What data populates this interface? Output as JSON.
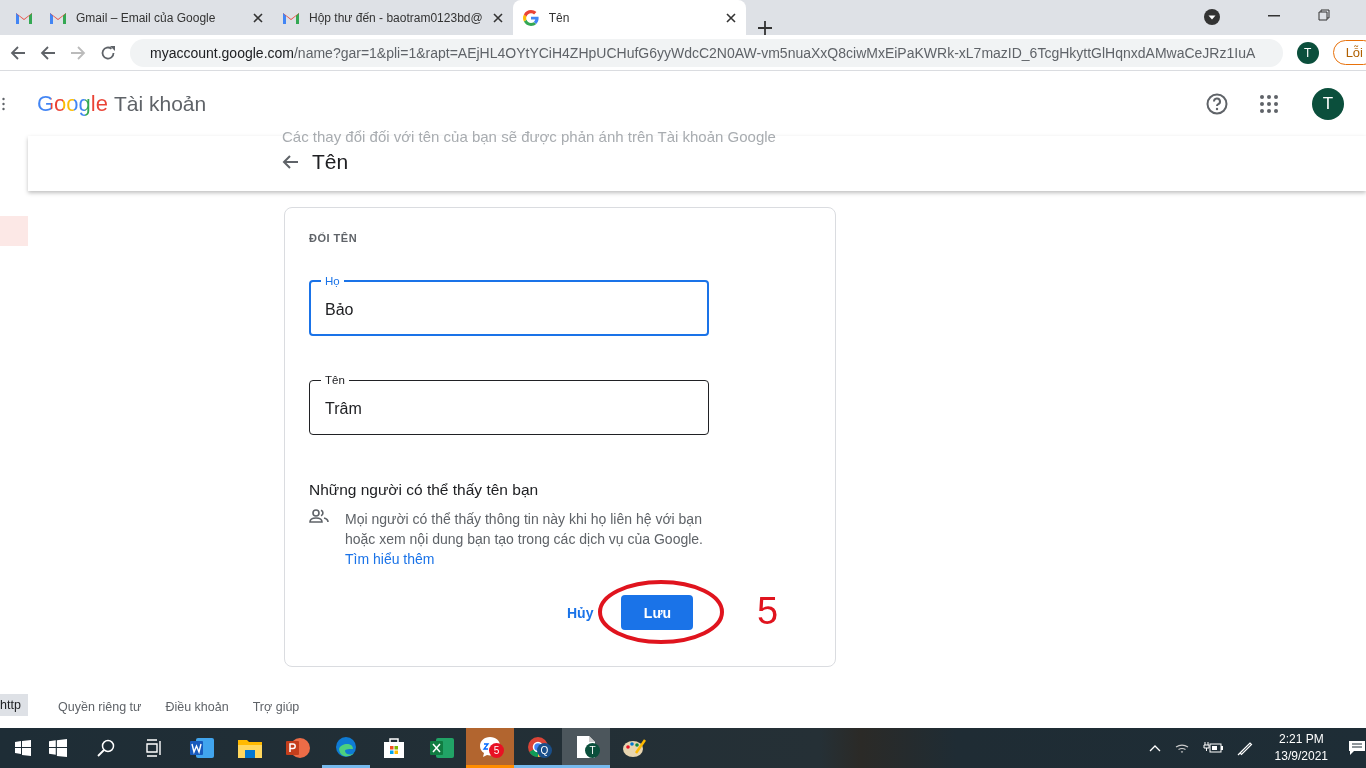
{
  "browser": {
    "tabs": [
      {
        "kind": "pinned",
        "selected": false
      },
      {
        "kind": "normal",
        "title": "Gmail – Email của Google",
        "selected": false
      },
      {
        "kind": "normal",
        "title": "Hộp thư đến - baotram0123bd@",
        "selected": false
      },
      {
        "kind": "normal",
        "title": "Tên",
        "selected": true
      }
    ],
    "url_host": "myaccount.google.com",
    "url_path": "/name?gar=1&pli=1&rapt=AEjHL4OYtYCiH4ZHpUCHufG6yyWdcC2N0AW-vm5nuaXxQ8ciwMxEiPaKWRk-xL7mazID_6TcgHkyttGlHqnxdAMwaCeJRz1IuA",
    "profile": "T",
    "error_button": "Lỗi"
  },
  "app": {
    "brand": "Google",
    "product": "Tài khoản",
    "avatar": "T",
    "notice": "Các thay đổi đối với tên của bạn sẽ được phản ánh trên Tài khoản Google",
    "title": "Tên",
    "card": {
      "section_label": "ĐỔI TÊN",
      "fields": [
        {
          "label": "Họ",
          "value": "Bảo",
          "focused": true
        },
        {
          "label": "Tên",
          "value": "Trâm",
          "focused": false
        }
      ],
      "visibility_heading": "Những người có thể thấy tên bạn",
      "visibility_text": "Mọi người có thể thấy thông tin này khi họ liên hệ với bạn hoặc xem nội dung bạn tạo trong các dịch vụ của Google.",
      "learn_more": "Tìm hiểu thêm",
      "cancel": "Hủy",
      "save": "Lưu",
      "annotation": "5"
    },
    "footer": [
      "Quyền riêng tư",
      "Điều khoản",
      "Trợ giúp"
    ],
    "status_tooltip": "http"
  },
  "taskbar": {
    "items": [
      {
        "kind": "start"
      },
      {
        "kind": "windows"
      },
      {
        "kind": "search"
      },
      {
        "kind": "taskview"
      },
      {
        "kind": "word"
      },
      {
        "kind": "explorer"
      },
      {
        "kind": "powerpoint"
      },
      {
        "kind": "edge",
        "running": true
      },
      {
        "kind": "store"
      },
      {
        "kind": "excel"
      },
      {
        "kind": "zalo",
        "running": true,
        "flashing": true,
        "badge": "5"
      },
      {
        "kind": "chrome",
        "running": true,
        "badge": "Q"
      },
      {
        "kind": "file",
        "running": true,
        "selected": true,
        "badge": "T"
      },
      {
        "kind": "paint"
      }
    ],
    "time": "2:21 PM",
    "date": "13/9/2021"
  }
}
